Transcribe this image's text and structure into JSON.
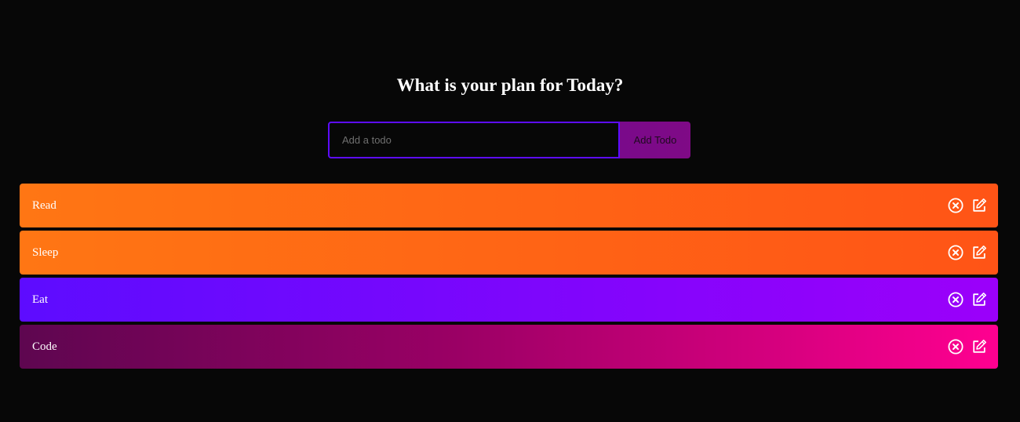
{
  "header": {
    "title": "What is your plan for Today?"
  },
  "form": {
    "placeholder": "Add a todo",
    "value": "",
    "button_label": "Add Todo"
  },
  "todos": [
    {
      "text": "Read",
      "delete_icon": "close-circle-icon",
      "edit_icon": "edit-icon"
    },
    {
      "text": "Sleep",
      "delete_icon": "close-circle-icon",
      "edit_icon": "edit-icon"
    },
    {
      "text": "Eat",
      "delete_icon": "close-circle-icon",
      "edit_icon": "edit-icon"
    },
    {
      "text": "Code",
      "delete_icon": "close-circle-icon",
      "edit_icon": "edit-icon"
    }
  ],
  "colors": {
    "background": "#070707",
    "input_border": "#5d0cff",
    "orange_start": "#ff7614",
    "orange_end": "#ff5416",
    "purple_start": "#5d0cff",
    "purple_end": "#9b00fa",
    "pink_start": "#5e0650",
    "pink_end": "#ff0090"
  }
}
